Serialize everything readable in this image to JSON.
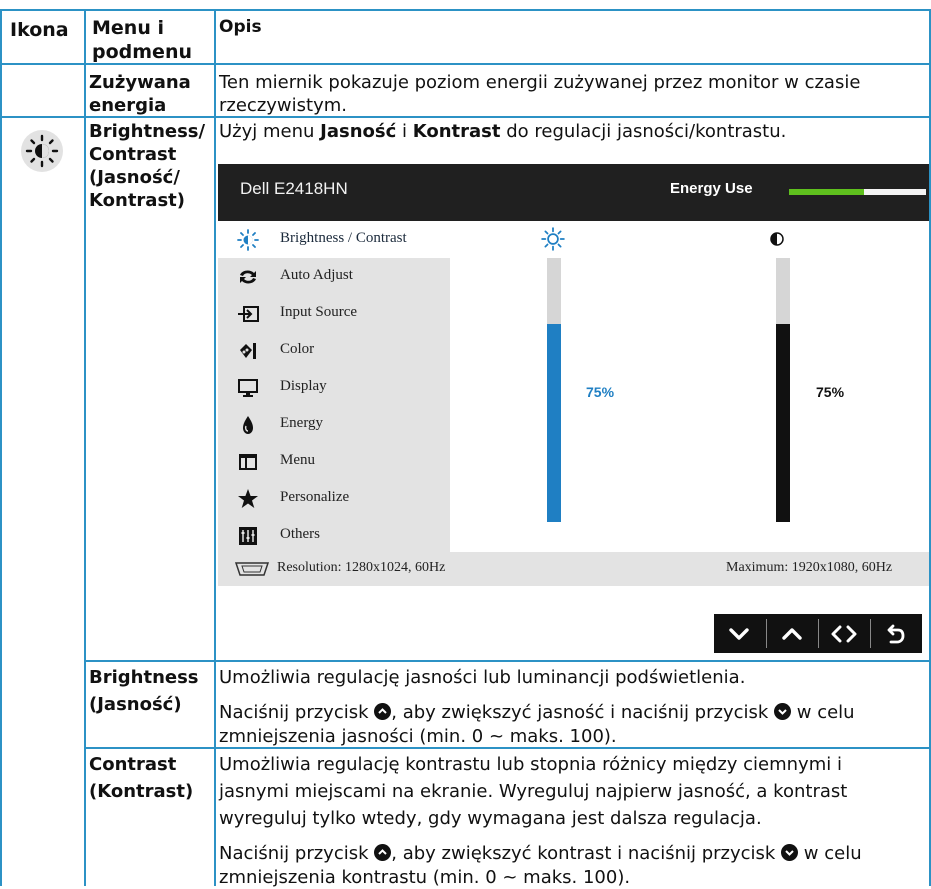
{
  "table": {
    "headers": {
      "icon": "Ikona",
      "menu": "Menu i podmenu",
      "desc": "Opis"
    },
    "rows": {
      "energy": {
        "menu": "Zużywana energia",
        "desc": "Ten miernik pokazuje poziom energii zużywanej przez monitor w czasie rzeczywistym."
      },
      "brightness_contrast": {
        "menu_line1": "Brightness/",
        "menu_line2": "Contrast",
        "menu_line3": "(Jasność/",
        "menu_line4": "Kontrast)",
        "desc_prefix": "Użyj menu ",
        "desc_bold1": "Jasność",
        "desc_mid": " i ",
        "desc_bold2": "Kontrast",
        "desc_suffix": " do regulacji jasności/kontrastu."
      },
      "brightness": {
        "menu_line1": "Brightness",
        "menu_line2": "(Jasność)",
        "desc1": "Umożliwia regulację jasności lub luminancji podświetlenia.",
        "desc2_a": "Naciśnij przycisk ",
        "desc2_b": ", aby zwiększyć jasność i naciśnij przycisk ",
        "desc2_c": " w celu",
        "desc2_line2": "zmniejszenia jasności (min. 0 ~ maks. 100)."
      },
      "contrast": {
        "menu_line1": "Contrast",
        "menu_line2": "(Kontrast)",
        "desc1_line1": "Umożliwia regulację kontrastu lub stopnia różnicy między ciemnymi i",
        "desc1_line2": "jasnymi miejscami na ekranie. Wyreguluj najpierw jasność, a kontrast",
        "desc1_line3": "wyreguluj tylko wtedy, gdy wymagana jest dalsza regulacja.",
        "desc2_a": "Naciśnij przycisk ",
        "desc2_b": ", aby zwiększyć kontrast i naciśnij przycisk ",
        "desc2_c": " w celu",
        "desc2_line2": "zmniejszenia kontrastu (min. 0 ~ maks. 100)."
      }
    }
  },
  "osd": {
    "model": "Dell E2418HN",
    "energy_label": "Energy Use",
    "energy_level": 0.55,
    "menu_items": [
      {
        "label": "Brightness / Contrast",
        "icon": "sun-icon"
      },
      {
        "label": "Auto Adjust",
        "icon": "auto-adjust-icon"
      },
      {
        "label": "Input Source",
        "icon": "input-source-icon"
      },
      {
        "label": "Color",
        "icon": "color-icon"
      },
      {
        "label": "Display",
        "icon": "display-icon"
      },
      {
        "label": "Energy",
        "icon": "energy-icon"
      },
      {
        "label": "Menu",
        "icon": "menu-icon"
      },
      {
        "label": "Personalize",
        "icon": "star-icon"
      },
      {
        "label": "Others",
        "icon": "others-icon"
      }
    ],
    "brightness": {
      "percent_label": "75%",
      "value": 0.75
    },
    "contrast": {
      "percent_label": "75%",
      "value": 0.75
    },
    "resolution": "Resolution: 1280x1024, 60Hz",
    "maximum": "Maximum: 1920x1080, 60Hz",
    "nav_buttons": [
      "chevron-down-icon",
      "chevron-up-icon",
      "left-right-icon",
      "back-icon"
    ],
    "colors": {
      "brightness_fill": "#1f7fc3",
      "contrast_fill": "#111111",
      "energy_fill": "#5fc01e",
      "grid": "#2c92c5"
    }
  }
}
